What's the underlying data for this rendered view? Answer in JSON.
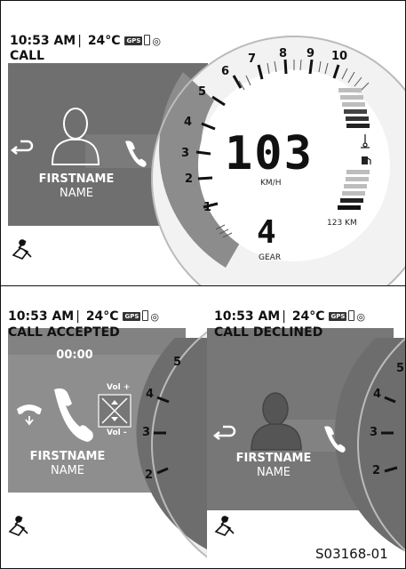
{
  "status": {
    "time": "10:53 AM",
    "temp": "24°C",
    "gps": "GPS"
  },
  "screens": {
    "call": {
      "title": "CALL",
      "firstname": "FIRSTNAME",
      "name": "NAME",
      "speed": "103",
      "speed_unit": "KM/H",
      "gear": "4",
      "gear_label": "GEAR",
      "range": "123 KM",
      "tach_labels": [
        "1",
        "2",
        "3",
        "4",
        "5",
        "6",
        "7",
        "8",
        "9",
        "10"
      ]
    },
    "call_accepted": {
      "title": "CALL ACCEPTED",
      "timer": "00:00",
      "vol_plus": "Vol +",
      "vol_minus": "Vol -",
      "firstname": "FIRSTNAME",
      "name": "NAME",
      "tach_labels": [
        "2",
        "3",
        "4",
        "5"
      ]
    },
    "call_declined": {
      "title": "CALL DECLINED",
      "firstname": "FIRSTNAME",
      "name": "NAME",
      "tach_labels": [
        "2",
        "3",
        "4",
        "5"
      ]
    }
  },
  "reference": "S03168-01",
  "colors": {
    "band_dark": "#6e6e6e",
    "band_light": "#9a9a9a",
    "gauge_gray": "#8a8a8a"
  },
  "icons": [
    "back-arrow-icon",
    "answer-phone-icon",
    "decline-phone-icon",
    "person-silhouette-icon",
    "rider-icon",
    "fuel-icon",
    "coolant-temp-icon",
    "volume-control-icon"
  ]
}
